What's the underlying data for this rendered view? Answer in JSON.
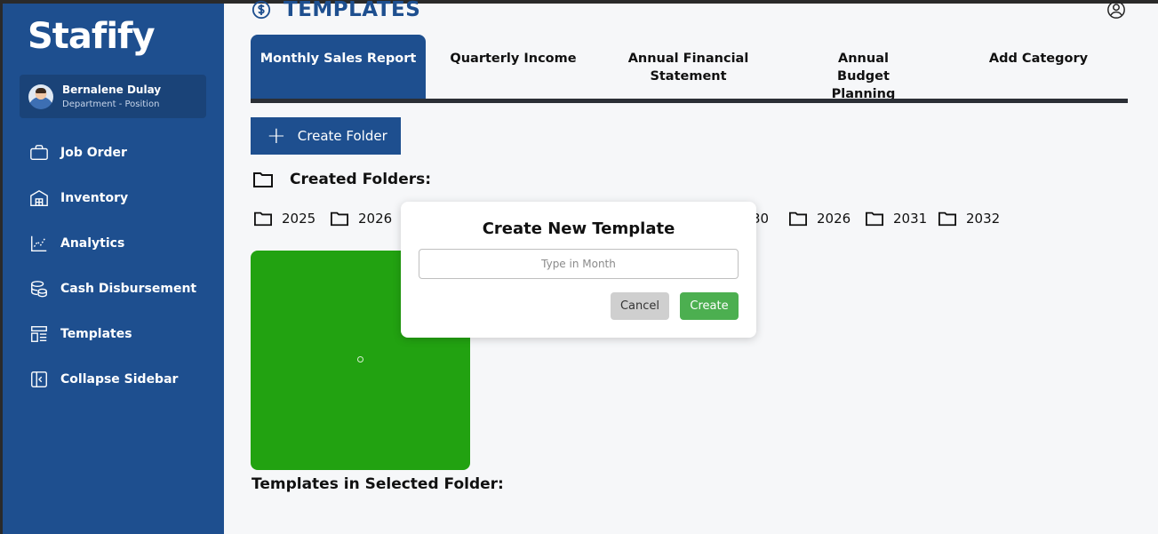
{
  "app": {
    "logo": "Stafify"
  },
  "user": {
    "name": "Bernalene Dulay",
    "subtitle": "Department - Position"
  },
  "sidebar": {
    "items": [
      {
        "label": "Job Order",
        "icon": "briefcase-icon"
      },
      {
        "label": "Inventory",
        "icon": "warehouse-icon"
      },
      {
        "label": "Analytics",
        "icon": "chart-icon"
      },
      {
        "label": "Cash Disbursement",
        "icon": "coins-icon"
      },
      {
        "label": "Templates",
        "icon": "templates-icon"
      },
      {
        "label": "Collapse Sidebar",
        "icon": "collapse-icon"
      }
    ]
  },
  "header": {
    "title": "TEMPLATES",
    "title_icon": "dollar-circle-icon",
    "profile_icon": "user-circle-icon"
  },
  "tabs": [
    {
      "label": "Monthly Sales Report",
      "active": true
    },
    {
      "label": "Quarterly Income",
      "active": false
    },
    {
      "label": "Annual Financial Statement",
      "active": false
    },
    {
      "label": "Annual Budget Planning",
      "active": false
    },
    {
      "label": "Add Category",
      "active": false
    }
  ],
  "toolbar": {
    "create_folder_label": "Create Folder"
  },
  "folders_section": {
    "heading": "Created Folders:",
    "folders": [
      "2025",
      "2026",
      "30",
      "2026",
      "2031",
      "2032"
    ]
  },
  "templates_section": {
    "heading": "Templates in Selected Folder:"
  },
  "modal": {
    "title": "Create New Template",
    "input_placeholder": "Type in Month",
    "input_value": "",
    "cancel_label": "Cancel",
    "create_label": "Create"
  },
  "colors": {
    "primary": "#1e4f8f",
    "sidebar": "#1e4f8f",
    "create_button": "#4caf50",
    "cancel_button": "#cfcfcf",
    "card_green": "#22a211"
  }
}
